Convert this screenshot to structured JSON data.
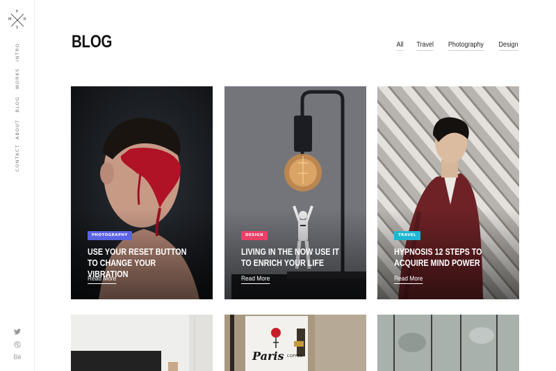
{
  "logo": {
    "letters": {
      "top": "P",
      "left": "M",
      "right": "R",
      "bottom": "S"
    }
  },
  "sidebar": {
    "nav": [
      {
        "label": "INTRO"
      },
      {
        "label": "WORKS"
      },
      {
        "label": "BLOG"
      },
      {
        "label": "ABOUT"
      },
      {
        "label": "CONTACT"
      }
    ],
    "social": [
      {
        "icon": "twitter-icon"
      },
      {
        "icon": "dribbble-icon"
      },
      {
        "icon": "behance-icon",
        "text": "Bē"
      }
    ]
  },
  "page": {
    "title": "BLOG"
  },
  "filters": [
    {
      "label": "All"
    },
    {
      "label": "Travel"
    },
    {
      "label": "Photography"
    },
    {
      "label": "Design"
    }
  ],
  "posts": [
    {
      "category": "PHOTOGRAPHY",
      "category_color": "#5b63e6",
      "title": "USE YOUR RESET BUTTON TO CHANGE YOUR VIBRATION",
      "cta": "Read More"
    },
    {
      "category": "DESIGN",
      "category_color": "#ec4068",
      "title": "LIVING IN THE NOW USE IT TO ENRICH YOUR LIFE",
      "cta": "Read More"
    },
    {
      "category": "TRAVEL",
      "category_color": "#1fb6d4",
      "title": "HYPNOSIS 12 STEPS TO ACQUIRE MIND POWER",
      "cta": "Read More"
    }
  ],
  "partial_posts": [
    {
      "image": "room-photo"
    },
    {
      "image": "paris-coffee-sign-photo",
      "sign_text": "Paris",
      "sign_sub": "COFFEE"
    },
    {
      "image": "wall-texture-photo"
    }
  ]
}
